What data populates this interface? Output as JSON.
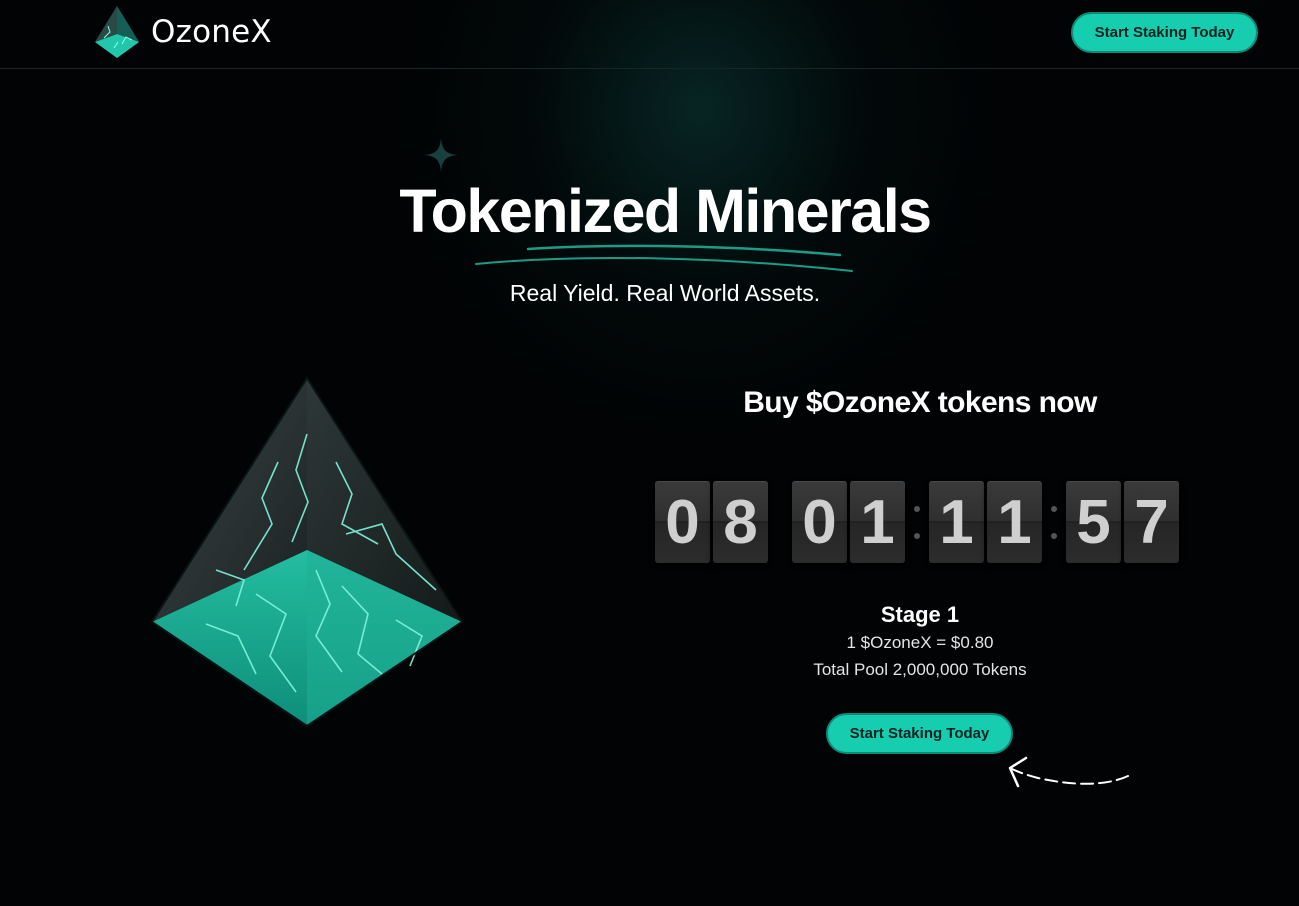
{
  "header": {
    "logo_text": "OzoneX",
    "cta_label": "Start Staking Today"
  },
  "hero": {
    "title": "Tokenized Minerals",
    "subtitle": "Real Yield. Real World Assets."
  },
  "presale": {
    "title": "Buy $OzoneX tokens now",
    "countdown": {
      "days": [
        "0",
        "8"
      ],
      "hours": [
        "0",
        "1"
      ],
      "minutes": [
        "1",
        "1"
      ],
      "seconds": [
        "5",
        "7"
      ]
    },
    "stage": "Stage 1",
    "price": "1 $OzoneX = $0.80",
    "pool": "Total Pool 2,000,000 Tokens",
    "cta_label": "Start Staking Today"
  },
  "icons": {
    "logo": "pyramid-logo-icon",
    "sparkle": "sparkle-icon",
    "arrow": "curved-arrow-icon",
    "gem": "pyramid-crystal-illustration"
  },
  "colors": {
    "accent": "#16cdb0",
    "background": "#010304",
    "flip_card": "#2f2f2f",
    "flip_digit": "#cfcfcf"
  }
}
